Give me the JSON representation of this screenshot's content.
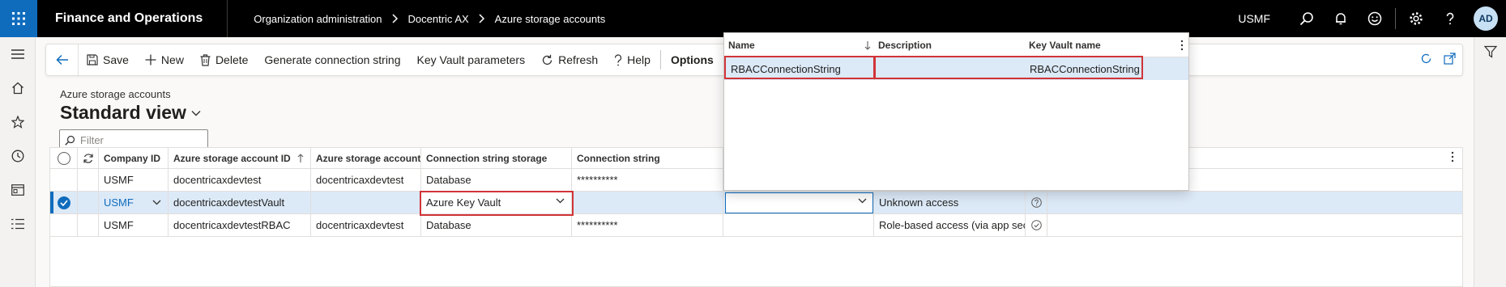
{
  "topbar": {
    "app_title": "Finance and Operations",
    "breadcrumb": [
      "Organization administration",
      "Docentric AX",
      "Azure storage accounts"
    ],
    "company": "USMF",
    "avatar_initials": "AD"
  },
  "actions": {
    "save": "Save",
    "new": "New",
    "delete": "Delete",
    "generate": "Generate connection string",
    "keyvault_params": "Key Vault parameters",
    "refresh": "Refresh",
    "help": "Help",
    "options": "Options"
  },
  "page": {
    "caption": "Azure storage accounts",
    "view_title": "Standard view",
    "filter_placeholder": "Filter"
  },
  "grid": {
    "columns": {
      "company_id": "Company ID",
      "account_id": "Azure storage account ID",
      "account_name": "Azure storage account na...",
      "cs_storage": "Connection string storage",
      "connection_string": "Connection string"
    },
    "rows": [
      {
        "company": "USMF",
        "account_id": "docentricaxdevtest",
        "account_name": "docentricaxdevtest",
        "cs_storage": "Database",
        "connection_string": "**********",
        "keyvault": "",
        "access": ""
      },
      {
        "company": "USMF",
        "account_id": "docentricaxdevtestVault",
        "account_name": "",
        "cs_storage": "Azure Key Vault",
        "connection_string": "",
        "keyvault": "",
        "access": "Unknown access"
      },
      {
        "company": "USMF",
        "account_id": "docentricaxdevtestRBAC",
        "account_name": "docentricaxdevtest",
        "cs_storage": "Database",
        "connection_string": "**********",
        "keyvault": "",
        "access": "Role-based access (via app secret)"
      }
    ]
  },
  "lookup": {
    "columns": {
      "name": "Name",
      "description": "Description",
      "keyvault_name": "Key Vault name"
    },
    "rows": [
      {
        "name": "RBACConnectionString",
        "description": "",
        "keyvault_name": "RBACConnectionString"
      }
    ]
  },
  "colors": {
    "accent": "#0f6cbd",
    "topbar": "#000000",
    "selected_row": "#dce9f7",
    "highlight_box": "#d13438"
  },
  "icons": [
    "waffle-icon",
    "chevron-right-icon",
    "search-icon",
    "bell-icon",
    "smiley-icon",
    "gear-icon",
    "help-icon",
    "hamburger-icon",
    "home-icon",
    "star-icon",
    "clock-icon",
    "workspace-icon",
    "list-icon",
    "filter-funnel-icon",
    "back-arrow-icon",
    "save-icon",
    "plus-icon",
    "trash-icon",
    "refresh-icon",
    "question-icon",
    "chevron-down-icon",
    "more-vertical-icon",
    "refresh-circle-icon",
    "sort-arrow-icon",
    "check-circle-icon"
  ]
}
